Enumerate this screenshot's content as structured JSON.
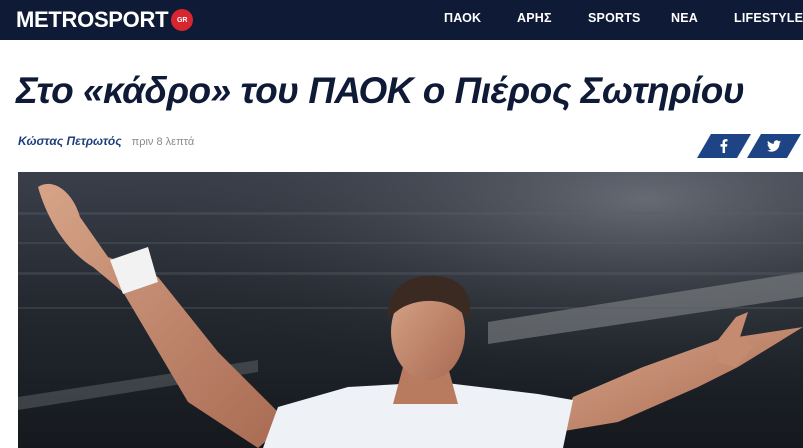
{
  "brand": {
    "logo_text": "METROSPORT",
    "logo_badge": "GR"
  },
  "nav": {
    "items": [
      "ΠΑΟΚ",
      "ΑΡΗΣ",
      "SPORTS",
      "ΝΕΑ",
      "LIFESTYLE"
    ]
  },
  "article": {
    "headline": "Στο «κάδρο» του ΠΑΟΚ ο Πιέρος Σωτηρίου",
    "author": "Κώστας Πετρωτός",
    "time": "πριν 8 λεπτά"
  },
  "share": {
    "facebook_icon": "facebook-icon",
    "twitter_icon": "twitter-icon"
  },
  "colors": {
    "header_bg": "#0f1b36",
    "headline": "#0f1b36",
    "author": "#1e3f7a",
    "share_bg": "#1e4485",
    "badge_red": "#d7262e"
  }
}
